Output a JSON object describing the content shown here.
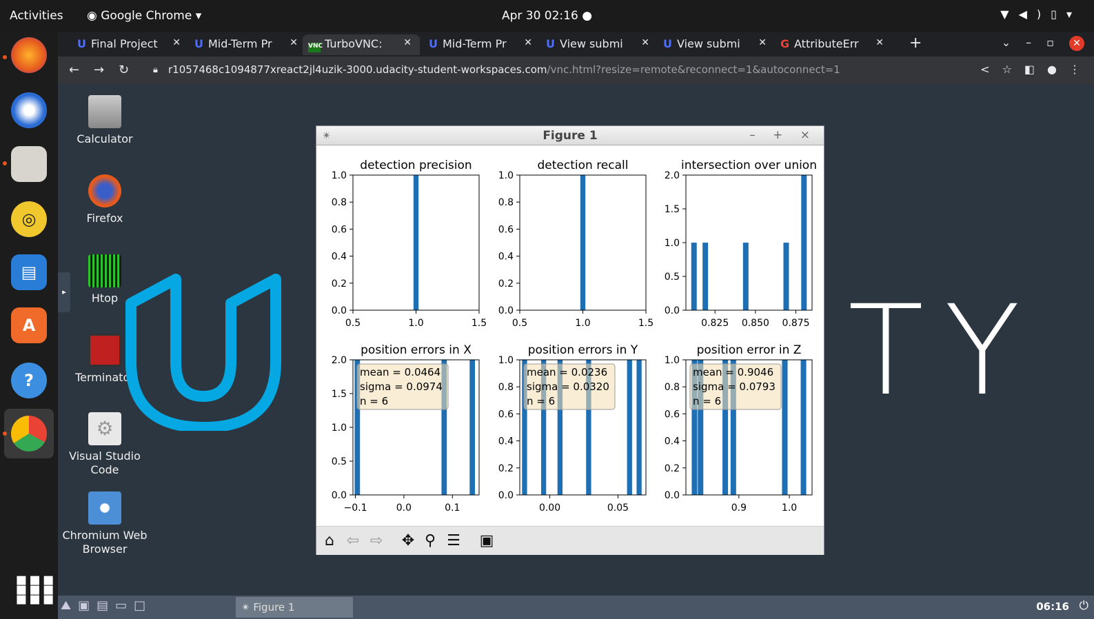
{
  "system_bar": {
    "activities": "Activities",
    "app_menu": "Google Chrome",
    "clock": "Apr 30  02:16"
  },
  "tabs": [
    {
      "label": "Final Project"
    },
    {
      "label": "Mid-Term Pr"
    },
    {
      "label": "TurboVNC: "
    },
    {
      "label": "Mid-Term Pr"
    },
    {
      "label": "View submi"
    },
    {
      "label": "View submi"
    },
    {
      "label": "AttributeErr"
    }
  ],
  "address_bar": {
    "host": "r1057468c1094877xreact2jl4uzik-3000.udacity-student-workspaces.com",
    "path": "/vnc.html?resize=remote&reconnect=1&autoconnect=1"
  },
  "desktop_icons": [
    {
      "label": "Calculator"
    },
    {
      "label": "Firefox"
    },
    {
      "label": "Htop"
    },
    {
      "label": "Terminator"
    },
    {
      "label": "Visual Studio Code"
    },
    {
      "label": "Chromium Web Browser"
    }
  ],
  "watermark": {
    "text": "TY"
  },
  "figure_window": {
    "title": "Figure 1",
    "controls": "– + ×"
  },
  "taskbar": {
    "task_label": "Figure 1",
    "time": "06:16"
  },
  "chart_data": [
    {
      "type": "bar",
      "title": "detection precision",
      "x": [
        1.0
      ],
      "values": [
        1
      ],
      "xlim": [
        0.5,
        1.5
      ],
      "ylim": [
        0,
        1.0
      ],
      "xticks": [
        0.5,
        1.0,
        1.5
      ],
      "yticks": [
        0.0,
        0.2,
        0.4,
        0.6,
        0.8,
        1.0
      ],
      "xtick_labels": [
        "0.5",
        "1.0",
        "1.5"
      ],
      "ytick_labels": [
        "0.0",
        "0.2",
        "0.4",
        "0.6",
        "0.8",
        "1.0"
      ],
      "bar_width": 0.04,
      "color": "#1f6fb4"
    },
    {
      "type": "bar",
      "title": "detection recall",
      "x": [
        1.0
      ],
      "values": [
        1
      ],
      "xlim": [
        0.5,
        1.5
      ],
      "ylim": [
        0,
        1.0
      ],
      "xticks": [
        0.5,
        1.0,
        1.5
      ],
      "yticks": [
        0.0,
        0.2,
        0.4,
        0.6,
        0.8,
        1.0
      ],
      "xtick_labels": [
        "0.5",
        "1.0",
        "1.5"
      ],
      "ytick_labels": [
        "0.0",
        "0.2",
        "0.4",
        "0.6",
        "0.8",
        "1.0"
      ],
      "bar_width": 0.04,
      "color": "#1f6fb4"
    },
    {
      "type": "bar",
      "title": "intersection over union",
      "x": [
        0.812,
        0.819,
        0.844,
        0.869,
        0.88
      ],
      "values": [
        1,
        1,
        1,
        1,
        2
      ],
      "xlim": [
        0.807,
        0.885
      ],
      "ylim": [
        0,
        2.0
      ],
      "xticks": [
        0.825,
        0.85,
        0.875
      ],
      "yticks": [
        0.0,
        0.5,
        1.0,
        1.5,
        2.0
      ],
      "xtick_labels": [
        "0.825",
        "0.850",
        "0.875"
      ],
      "ytick_labels": [
        "0.0",
        "0.5",
        "1.0",
        "1.5",
        "2.0"
      ],
      "bar_width": 0.0034,
      "color": "#1f6fb4"
    },
    {
      "type": "bar",
      "title": "position errors in X",
      "x": [
        -0.096,
        0.083,
        0.141
      ],
      "values": [
        2,
        2,
        2
      ],
      "xlim": [
        -0.105,
        0.155
      ],
      "ylim": [
        0,
        2.0
      ],
      "xticks": [
        -0.1,
        0.0,
        0.1
      ],
      "yticks": [
        0.0,
        0.5,
        1.0,
        1.5,
        2.0
      ],
      "xtick_labels": [
        "−0.1",
        "0.0",
        "0.1"
      ],
      "ytick_labels": [
        "0.0",
        "0.5",
        "1.0",
        "1.5",
        "2.0"
      ],
      "bar_width": 0.011,
      "color": "#1f6fb4",
      "annotation": [
        "mean = 0.0464",
        "sigma = 0.0974",
        "n = 6"
      ]
    },
    {
      "type": "bar",
      "title": "position errors in Y",
      "x": [
        -0.0185,
        -0.0045,
        0.0075,
        0.0285,
        0.0585,
        0.0655
      ],
      "values": [
        1,
        1,
        1,
        1,
        1,
        1
      ],
      "xlim": [
        -0.022,
        0.0705
      ],
      "ylim": [
        0,
        1.0
      ],
      "xticks": [
        0.0,
        0.05
      ],
      "yticks": [
        0.0,
        0.2,
        0.4,
        0.6,
        0.8,
        1.0
      ],
      "xtick_labels": [
        "0.00",
        "0.05"
      ],
      "ytick_labels": [
        "0.0",
        "0.2",
        "0.4",
        "0.6",
        "0.8",
        "1.0"
      ],
      "bar_width": 0.0037,
      "color": "#1f6fb4",
      "annotation": [
        "mean = 0.0236",
        "sigma = 0.0320",
        "n = 6"
      ]
    },
    {
      "type": "bar",
      "title": "position error in Z",
      "x": [
        0.812,
        0.824,
        0.873,
        0.889,
        0.991,
        1.028
      ],
      "values": [
        1,
        1,
        1,
        1,
        1,
        1
      ],
      "xlim": [
        0.795,
        1.045
      ],
      "ylim": [
        0,
        1.0
      ],
      "xticks": [
        0.9,
        1.0
      ],
      "yticks": [
        0.0,
        0.2,
        0.4,
        0.6,
        0.8,
        1.0
      ],
      "xtick_labels": [
        "0.9",
        "1.0"
      ],
      "ytick_labels": [
        "0.0",
        "0.2",
        "0.4",
        "0.6",
        "0.8",
        "1.0"
      ],
      "bar_width": 0.011,
      "color": "#1f6fb4",
      "annotation": [
        "mean = 0.9046",
        "sigma = 0.0793",
        "n = 6"
      ]
    }
  ]
}
